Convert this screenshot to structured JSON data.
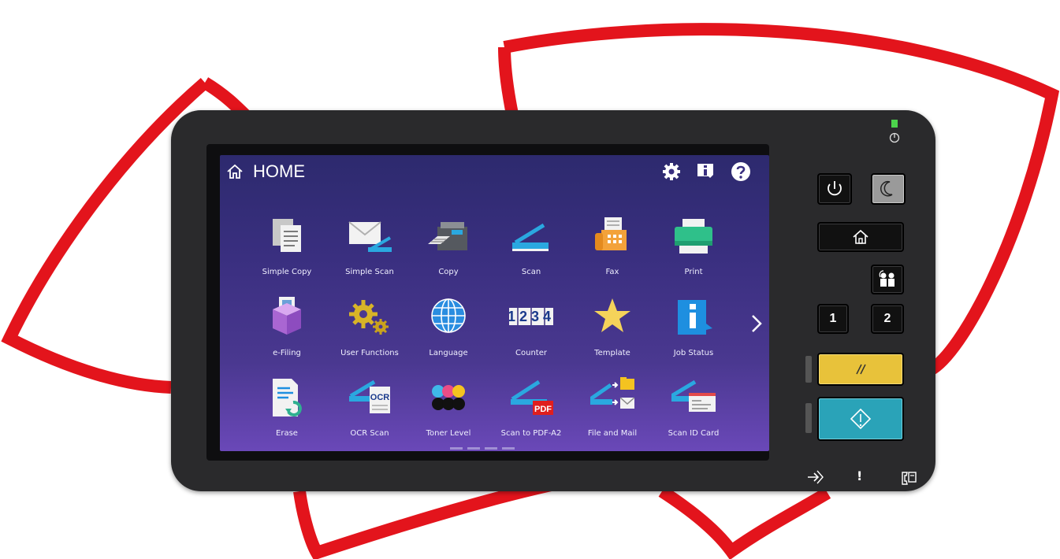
{
  "header": {
    "title": "HOME",
    "icons": [
      "home-icon",
      "settings-gear-icon",
      "info-icon",
      "help-icon"
    ]
  },
  "tiles": [
    {
      "label": "Simple Copy",
      "icon": "simple-copy-icon"
    },
    {
      "label": "Simple Scan",
      "icon": "simple-scan-icon"
    },
    {
      "label": "Copy",
      "icon": "copy-icon"
    },
    {
      "label": "Scan",
      "icon": "scan-icon"
    },
    {
      "label": "Fax",
      "icon": "fax-icon"
    },
    {
      "label": "Print",
      "icon": "print-icon"
    },
    {
      "label": "e-Filing",
      "icon": "e-filing-icon"
    },
    {
      "label": "User Functions",
      "icon": "user-functions-icon"
    },
    {
      "label": "Language",
      "icon": "language-globe-icon"
    },
    {
      "label": "Counter",
      "icon": "counter-icon"
    },
    {
      "label": "Template",
      "icon": "template-star-icon"
    },
    {
      "label": "Job Status",
      "icon": "job-status-icon"
    },
    {
      "label": "Erase",
      "icon": "erase-icon"
    },
    {
      "label": "OCR Scan",
      "icon": "ocr-scan-icon"
    },
    {
      "label": "Toner Level",
      "icon": "toner-level-icon"
    },
    {
      "label": "Scan to PDF-A2",
      "icon": "scan-to-pdf-icon"
    },
    {
      "label": "File and Mail",
      "icon": "file-and-mail-icon"
    },
    {
      "label": "Scan ID Card",
      "icon": "scan-id-card-icon"
    }
  ],
  "icon_texts": {
    "counter": "1234",
    "ocr": "OCR",
    "pdf": "PDF"
  },
  "panel": {
    "button_1": "1",
    "button_2": "2",
    "status_exclaim": "!"
  },
  "colors": {
    "brand_red": "#e3141c",
    "screen_top": "#2d2a6e",
    "screen_bottom": "#6a48b8",
    "clear_button": "#e8c23a",
    "start_button": "#2aa3b8",
    "power_led": "#4cd44c"
  }
}
